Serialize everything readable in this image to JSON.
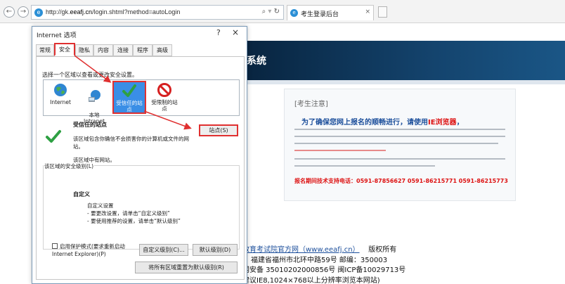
{
  "browser": {
    "back_glyph": "←",
    "forward_glyph": "→",
    "address_prefix": "http://gk.",
    "address_domain": "eeafj.cn",
    "address_suffix": "/login.shtml?method=autoLogin",
    "address_search_glyph": "⌕",
    "address_refresh_glyph": "↻",
    "tab_title": "考生登录后台",
    "tab_close_glyph": "×"
  },
  "page": {
    "banner_title": "系统",
    "notice_heading": "[考生注意]",
    "notice_lead": "为了确保您网上报名的顺畅进行，请使用",
    "notice_lead_red": "IE浏览器",
    "notice_lead_end": "，",
    "support_line": "报名期间技术支持电话：0591-87856627   0591-86215771   0591-86215773",
    "footer_link": "教育考试院官方网（www.eeafj.cn）",
    "footer_rights": "版权所有",
    "footer_address": "福建省福州市北环中路59号  邮编：350003",
    "footer_icp": "网安备 35010202000856号 闽ICP备10029713号",
    "footer_hint": "建议IE8,1024×768以上分辨率浏览本网站)"
  },
  "dialog": {
    "title": "Internet 选项",
    "help_glyph": "?",
    "close_glyph": "×",
    "tabs": [
      "常规",
      "安全",
      "隐私",
      "内容",
      "连接",
      "程序",
      "高级"
    ],
    "zone_prompt": "选择一个区域以查看或更改安全设置。",
    "zones": [
      {
        "label": "Internet"
      },
      {
        "label": "本地\nIntranet"
      },
      {
        "label": "受信任的站点"
      },
      {
        "label": "受限制的站点"
      }
    ],
    "zone_heading": "受信任的站点",
    "sites_button": "站点(S)",
    "zone_desc": "该区域包含你确信不会损害你的计算机或文件的网站。",
    "zone_empty": "该区域中有网站。",
    "security_legend": "该区域的安全级别(L)",
    "security_custom": "自定义",
    "security_lines": [
      "自定义设置",
      "- 要更改设置，请单击“自定义级别”",
      "- 要使用推荐的设置，请单击“默认级别”"
    ],
    "protect_mode": "启用保护模式(要求重新启动\nInternet Explorer)(P)",
    "custom_level_button": "自定义级别(C)...",
    "default_level_button": "默认级别(D)",
    "reset_all_button": "将所有区域重置为默认级别(R)"
  },
  "colors": {
    "highlight_red": "#e03030",
    "zone_selected_blue": "#3a8ee6",
    "banner_navy": "#0f3a62"
  }
}
